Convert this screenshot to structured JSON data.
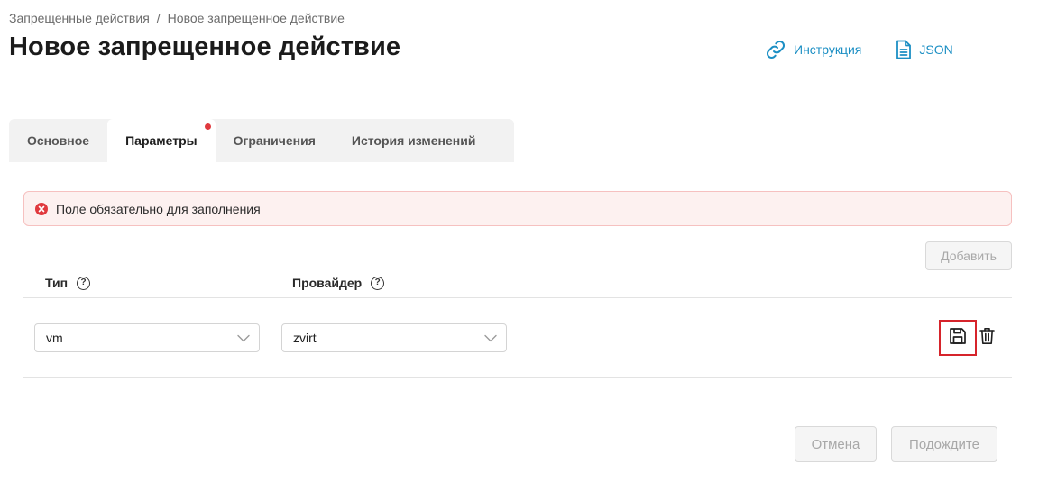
{
  "breadcrumb": {
    "parent": "Запрещенные действия",
    "separator": "/",
    "current": "Новое запрещенное действие"
  },
  "page_title": "Новое запрещенное действие",
  "header_links": {
    "instruction": "Инструкция",
    "json": "JSON"
  },
  "tabs": [
    {
      "label": "Основное",
      "active": false
    },
    {
      "label": "Параметры",
      "active": true,
      "has_error_dot": true
    },
    {
      "label": "Ограничения",
      "active": false
    },
    {
      "label": "История изменений",
      "active": false
    }
  ],
  "alert": {
    "message": "Поле обязательно для заполнения"
  },
  "add_button": "Добавить",
  "columns": {
    "type": "Тип",
    "provider": "Провайдер"
  },
  "row": {
    "type_value": "vm",
    "provider_value": "zvirt"
  },
  "footer": {
    "cancel": "Отмена",
    "wait": "Подождите"
  },
  "colors": {
    "link": "#1c8fc4",
    "error": "#e0393e",
    "highlight_border": "#d6242b"
  }
}
